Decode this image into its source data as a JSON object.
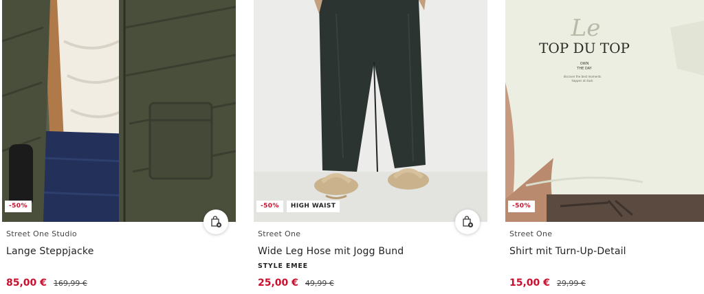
{
  "products": [
    {
      "badges": [
        "-50%"
      ],
      "brand": "Street One Studio",
      "title": "Lange Steppjacke",
      "tagline": "",
      "price_now": "85,00 €",
      "price_was": "169,99 €",
      "cart_icon": "shopping-bag-plus-icon"
    },
    {
      "badges": [
        "-50%",
        "HIGH WAIST"
      ],
      "brand": "Street One",
      "title": "Wide Leg Hose mit Jogg Bund",
      "tagline": "STYLE EMEE",
      "price_now": "25,00 €",
      "price_was": "49,99 €",
      "cart_icon": "shopping-bag-plus-icon"
    },
    {
      "badges": [
        "-50%"
      ],
      "brand": "Street One",
      "title": "Shirt mit Turn-Up-Detail",
      "tagline": "",
      "price_now": "15,00 €",
      "price_was": "29,99 €",
      "print": {
        "script": "Le",
        "headline": "TOP DU TOP",
        "line1": "OWN",
        "line2": "THE DAY",
        "small": "discover the best moments",
        "small2": "happen at dusk"
      }
    }
  ],
  "colors": {
    "sale": "#c8102e",
    "jacket": "#4a4f3c",
    "trousers": "#2b3431",
    "shirt": "#eceee1"
  }
}
